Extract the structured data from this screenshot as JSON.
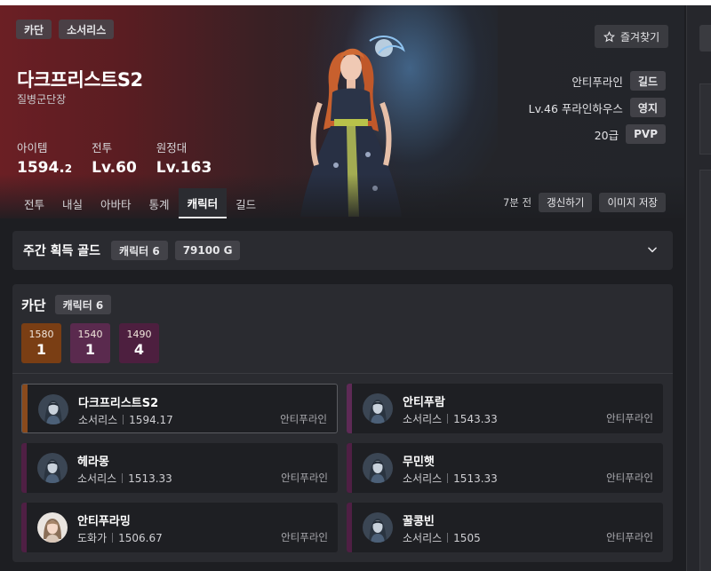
{
  "header": {
    "chips": [
      "카단",
      "소서리스"
    ],
    "name": "다크프리스트S2",
    "title": "질병군단장",
    "favorite_label": "즐겨찾기",
    "stats": [
      {
        "label": "아이템",
        "value_main": "1594.",
        "value_small": "2"
      },
      {
        "label": "전투",
        "value_main": "Lv.60",
        "value_small": ""
      },
      {
        "label": "원정대",
        "value_main": "Lv.163",
        "value_small": ""
      }
    ],
    "info_rows": [
      {
        "text": "안티푸라인",
        "chip": "길드"
      },
      {
        "text": "Lv.46 푸라인하우스",
        "chip": "영지"
      },
      {
        "text": "20급",
        "chip": "PVP"
      }
    ],
    "updated_ago": "7분 전",
    "refresh_label": "갱신하기",
    "save_image_label": "이미지 저장",
    "tabs": [
      "전투",
      "내실",
      "아바타",
      "통계",
      "캐릭터",
      "길드"
    ],
    "active_tab": "캐릭터"
  },
  "gold": {
    "title": "주간 획득 골드",
    "character_chip": "캐릭터 6",
    "amount_chip": "79100 G"
  },
  "roster": {
    "server": "카단",
    "count_chip": "캐릭터 6",
    "level_groups": [
      {
        "level": "1580",
        "count": "1",
        "color": "#7a3e14"
      },
      {
        "level": "1540",
        "count": "1",
        "color": "#5a2a4e"
      },
      {
        "level": "1490",
        "count": "4",
        "color": "#4d1f3f"
      }
    ],
    "characters": [
      {
        "name": "다크프리스트S2",
        "class": "소서리스",
        "level": "1594.17",
        "guild": "안티푸라인",
        "accent": "#8a4a1c",
        "selected": true,
        "avatar": "sorc"
      },
      {
        "name": "안티푸람",
        "class": "소서리스",
        "level": "1543.33",
        "guild": "안티푸라인",
        "accent": "#5e2a56",
        "selected": false,
        "avatar": "sorc"
      },
      {
        "name": "헤라몽",
        "class": "소서리스",
        "level": "1513.33",
        "guild": "안티푸라인",
        "accent": "#4f1f44",
        "selected": false,
        "avatar": "sorc"
      },
      {
        "name": "무민햇",
        "class": "소서리스",
        "level": "1513.33",
        "guild": "안티푸라인",
        "accent": "#4f1f44",
        "selected": false,
        "avatar": "sorc"
      },
      {
        "name": "안티푸라밍",
        "class": "도화가",
        "level": "1506.67",
        "guild": "안티푸라인",
        "accent": "#4f1f44",
        "selected": false,
        "avatar": "artist"
      },
      {
        "name": "꿀콩빈",
        "class": "소서리스",
        "level": "1505",
        "guild": "안티푸라인",
        "accent": "#4f1f44",
        "selected": false,
        "avatar": "sorc"
      }
    ]
  }
}
